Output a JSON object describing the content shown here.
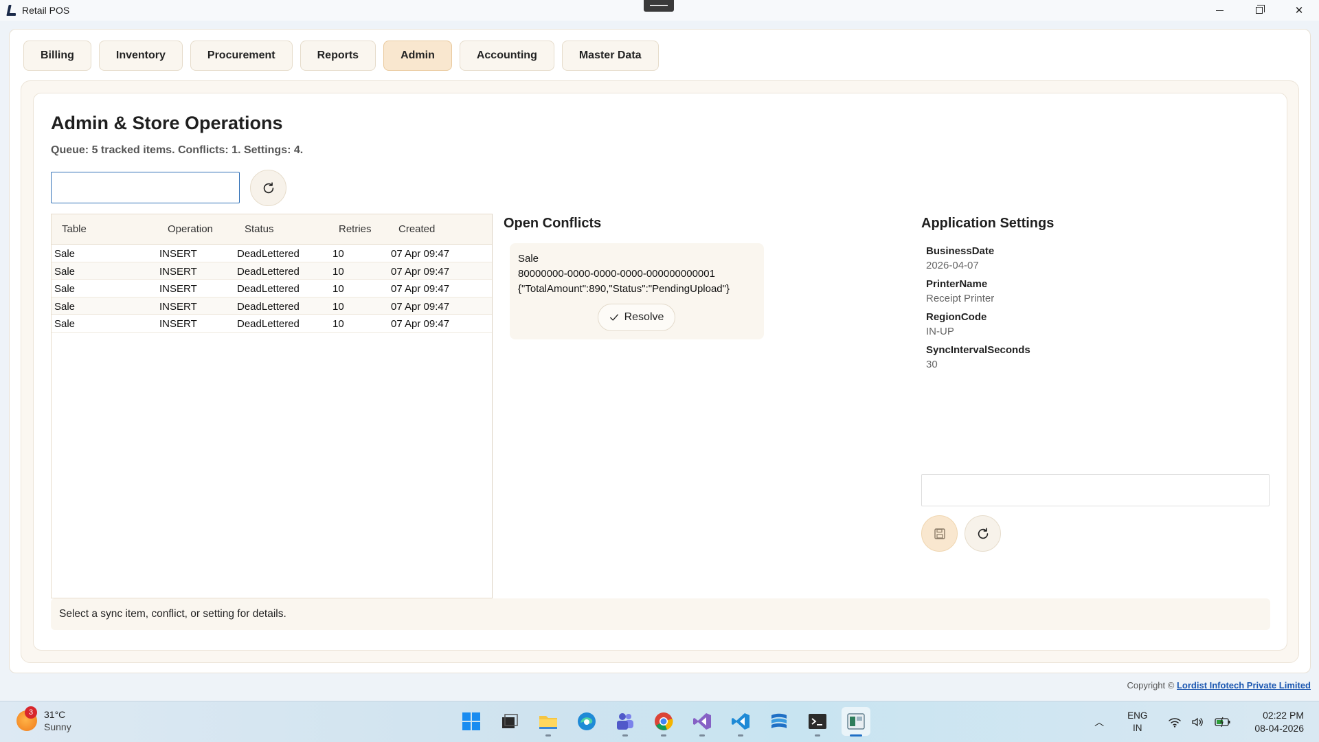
{
  "window": {
    "title": "Retail POS"
  },
  "tabs": [
    {
      "label": "Billing"
    },
    {
      "label": "Inventory"
    },
    {
      "label": "Procurement"
    },
    {
      "label": "Reports"
    },
    {
      "label": "Admin"
    },
    {
      "label": "Accounting"
    },
    {
      "label": "Master Data"
    }
  ],
  "page": {
    "title": "Admin & Store Operations",
    "subtitle": "Queue: 5 tracked items. Conflicts: 1. Settings: 4.",
    "search_value": ""
  },
  "sync_table": {
    "headers": {
      "table": "Table",
      "operation": "Operation",
      "status": "Status",
      "retries": "Retries",
      "created": "Created"
    },
    "rows": [
      {
        "table": "Sale",
        "operation": "INSERT",
        "status": "DeadLettered",
        "retries": "10",
        "created": "07 Apr 09:47"
      },
      {
        "table": "Sale",
        "operation": "INSERT",
        "status": "DeadLettered",
        "retries": "10",
        "created": "07 Apr 09:47"
      },
      {
        "table": "Sale",
        "operation": "INSERT",
        "status": "DeadLettered",
        "retries": "10",
        "created": "07 Apr 09:47"
      },
      {
        "table": "Sale",
        "operation": "INSERT",
        "status": "DeadLettered",
        "retries": "10",
        "created": "07 Apr 09:47"
      },
      {
        "table": "Sale",
        "operation": "INSERT",
        "status": "DeadLettered",
        "retries": "10",
        "created": "07 Apr 09:47"
      }
    ]
  },
  "conflicts": {
    "title": "Open Conflicts",
    "items": [
      {
        "table": "Sale",
        "id": "80000000-0000-0000-0000-000000000001",
        "payload": "{\"TotalAmount\":890,\"Status\":\"PendingUpload\"}",
        "resolve_label": "Resolve"
      }
    ]
  },
  "settings": {
    "title": "Application Settings",
    "items": [
      {
        "key": "BusinessDate",
        "value": "2026-04-07"
      },
      {
        "key": "PrinterName",
        "value": "Receipt Printer"
      },
      {
        "key": "RegionCode",
        "value": "IN-UP"
      },
      {
        "key": "SyncIntervalSeconds",
        "value": "30"
      }
    ],
    "edit_value": ""
  },
  "details": {
    "text": "Select a sync item, conflict, or setting for details."
  },
  "footer": {
    "copyright_label": "Copyright ©",
    "company": "Lordist Infotech Private Limited"
  },
  "taskbar": {
    "weather": {
      "temp": "31°C",
      "condition": "Sunny",
      "badge": "3"
    },
    "apps": [
      "start-icon",
      "task-view-icon",
      "file-explorer-icon",
      "edge-icon",
      "teams-icon",
      "chrome-icon",
      "visual-studio-icon",
      "vscode-icon",
      "azure-data-studio-icon",
      "terminal-icon",
      "retail-pos-icon"
    ],
    "language": {
      "line1": "ENG",
      "line2": "IN"
    },
    "clock": {
      "time": "02:22 PM",
      "date": "08-04-2026"
    }
  },
  "colors": {
    "accent_tab": "#f9e7cf",
    "panel_bg": "#fbf7f1",
    "link": "#1a56b0",
    "input_focus": "#2f6fb6"
  }
}
